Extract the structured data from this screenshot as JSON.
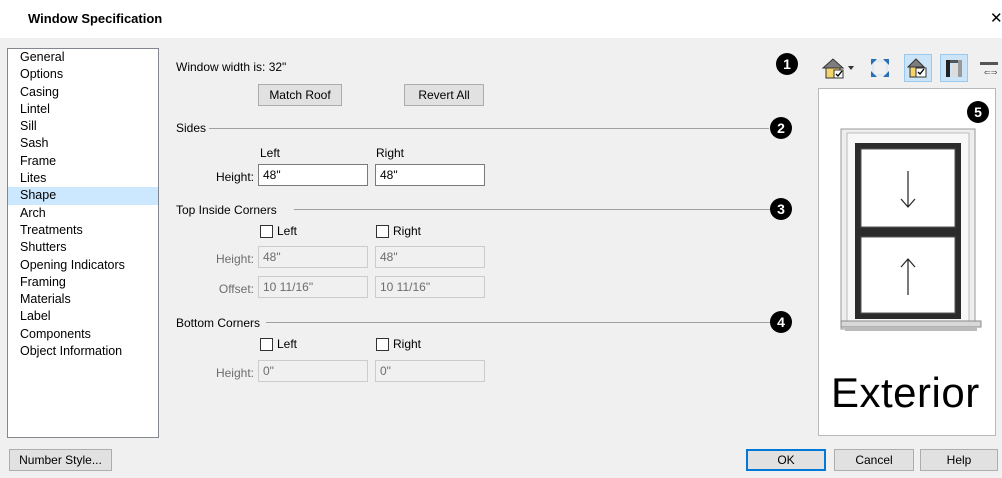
{
  "window": {
    "title": "Window Specification",
    "close_glyph": "✕"
  },
  "nav": {
    "items": [
      "General",
      "Options",
      "Casing",
      "Lintel",
      "Sill",
      "Sash",
      "Frame",
      "Lites",
      "Shape",
      "Arch",
      "Treatments",
      "Shutters",
      "Opening Indicators",
      "Framing",
      "Materials",
      "Label",
      "Components",
      "Object Information"
    ],
    "selected": "Shape"
  },
  "shape": {
    "width_text": "Window width is: 32\"",
    "match_roof": "Match Roof",
    "revert_all": "Revert All",
    "sides": {
      "title": "Sides",
      "left": "Left",
      "right": "Right",
      "height_label": "Height:",
      "left_height": "48\"",
      "right_height": "48\""
    },
    "top_inside_corners": {
      "title": "Top Inside Corners",
      "left": "Left",
      "right": "Right",
      "left_checked": false,
      "right_checked": false,
      "height_label": "Height:",
      "left_height": "48\"",
      "right_height": "48\"",
      "offset_label": "Offset:",
      "left_offset": "10 11/16\"",
      "right_offset": "10 11/16\""
    },
    "bottom_corners": {
      "title": "Bottom Corners",
      "left": "Left",
      "right": "Right",
      "left_checked": false,
      "right_checked": false,
      "height_label": "Height:",
      "left_height": "0\"",
      "right_height": "0\""
    }
  },
  "callouts": [
    "1",
    "2",
    "3",
    "4",
    "5"
  ],
  "preview": {
    "label": "Exterior"
  },
  "toolbar": {
    "icons": [
      "view-3d-icon",
      "fill-window-icon",
      "show-materials-icon",
      "show-casing-icon",
      "swing-side-icon"
    ]
  },
  "footer": {
    "number_style": "Number Style...",
    "ok": "OK",
    "cancel": "Cancel",
    "help": "Help"
  },
  "colors": {
    "selection": "#cce8ff",
    "accent": "#0078d7"
  }
}
